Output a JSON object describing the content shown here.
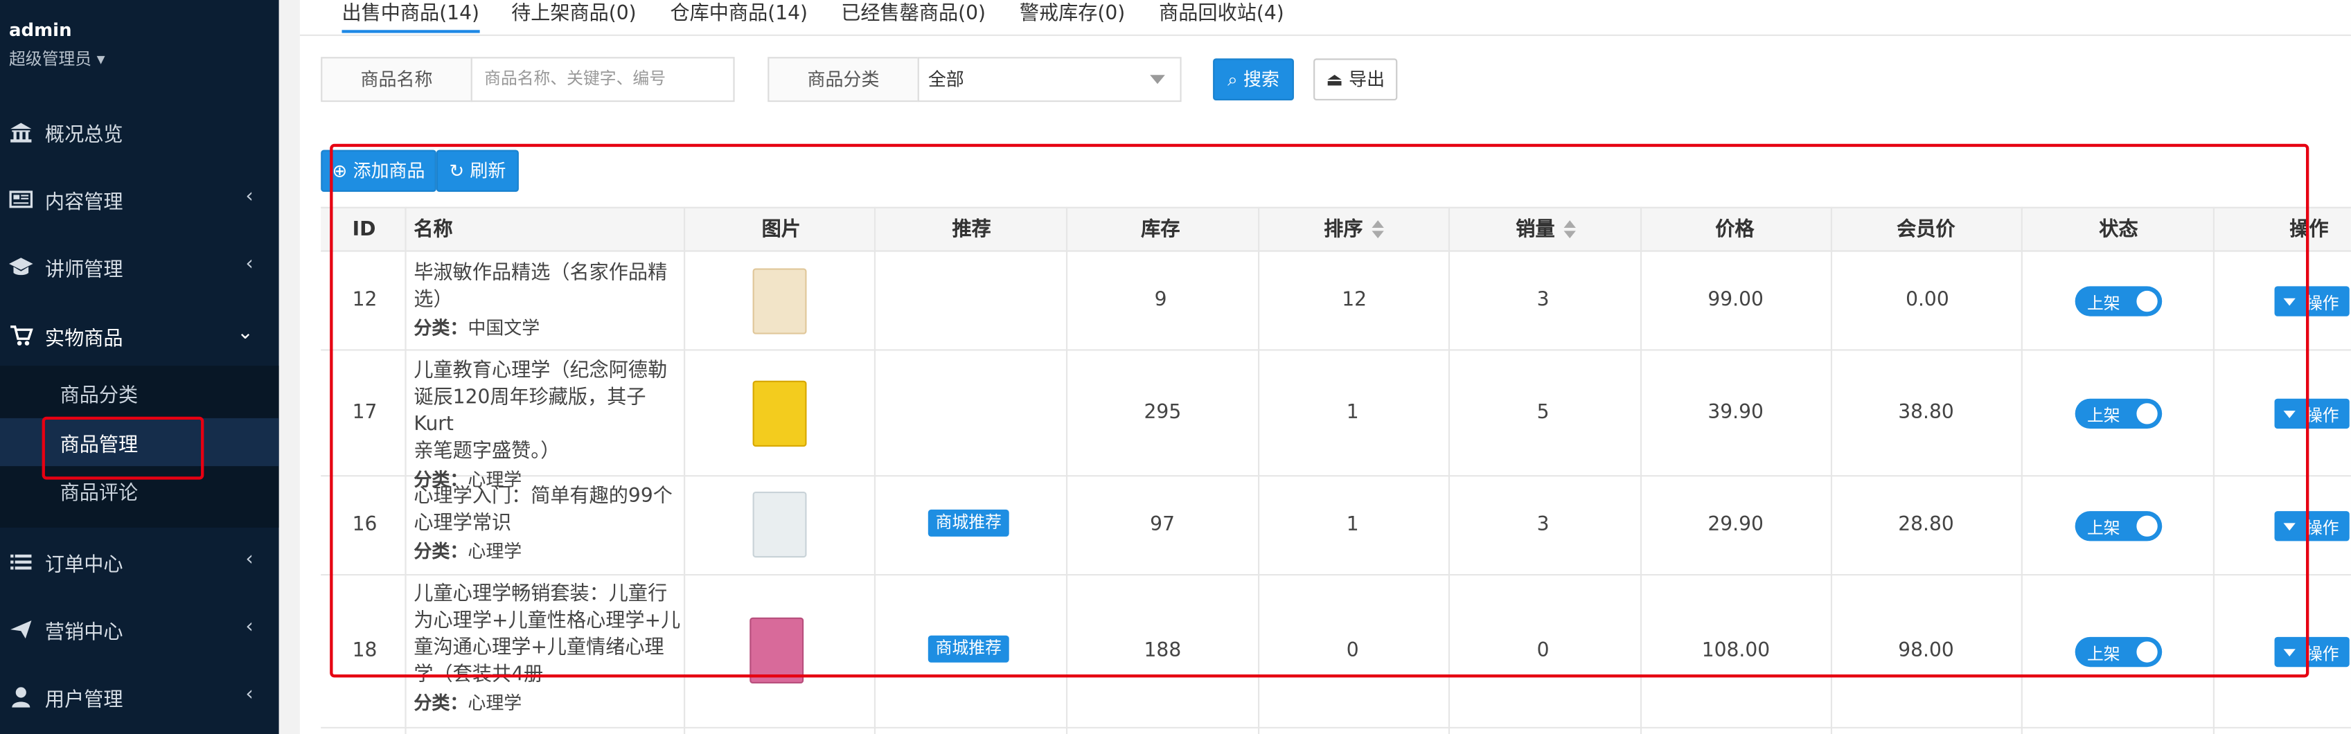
{
  "sidebar": {
    "user_name": "admin",
    "user_role": "超级管理员",
    "items": [
      {
        "label": "概况总览",
        "icon": "bank-icon"
      },
      {
        "label": "内容管理",
        "icon": "newspaper-icon"
      },
      {
        "label": "讲师管理",
        "icon": "graduation-cap-icon"
      },
      {
        "label": "实物商品",
        "icon": "cart-icon"
      },
      {
        "label": "订单中心",
        "icon": "list-icon"
      },
      {
        "label": "营销中心",
        "icon": "send-icon"
      },
      {
        "label": "用户管理",
        "icon": "user-icon"
      }
    ],
    "sub_items": [
      {
        "label": "商品分类"
      },
      {
        "label": "商品管理"
      },
      {
        "label": "商品评论"
      }
    ]
  },
  "tabs": [
    {
      "label": "出售中商品(14)"
    },
    {
      "label": "待上架商品(0)"
    },
    {
      "label": "仓库中商品(14)"
    },
    {
      "label": "已经售罄商品(0)"
    },
    {
      "label": "警戒库存(0)"
    },
    {
      "label": "商品回收站(4)"
    }
  ],
  "filters": {
    "name_label": "商品名称",
    "name_placeholder": "商品名称、关键字、编号",
    "category_label": "商品分类",
    "category_value": "全部",
    "search_label": "搜索",
    "export_label": "导出"
  },
  "actions": {
    "add_label": "添加商品",
    "refresh_label": "刷新"
  },
  "table": {
    "headers": {
      "id": "ID",
      "name": "名称",
      "image": "图片",
      "recommend": "推荐",
      "stock": "库存",
      "sort": "排序",
      "sales": "销量",
      "price": "价格",
      "member_price": "会员价",
      "status": "状态",
      "ops": "操作"
    },
    "category_prefix": "分类：",
    "status_label": "上架",
    "op_label": "操作",
    "rows": [
      {
        "id": "12",
        "name_lines": [
          "毕淑敏作品精选（名家作品精",
          "选）"
        ],
        "category": "中国文学",
        "recommend": "",
        "stock": "9",
        "sort": "12",
        "sales": "3",
        "price": "99.00",
        "member_price": "0.00",
        "thumb_color": "#f2e4c8"
      },
      {
        "id": "17",
        "name_lines": [
          "儿童教育心理学（纪念阿德勒",
          "诞辰120周年珍藏版，其子Kurt",
          "亲笔题字盛赞。）"
        ],
        "category": "心理学",
        "recommend": "",
        "stock": "295",
        "sort": "1",
        "sales": "5",
        "price": "39.90",
        "member_price": "38.80",
        "thumb_color": "#f3cc1e"
      },
      {
        "id": "16",
        "name_lines": [
          "心理学入门：简单有趣的99个",
          "心理学常识"
        ],
        "category": "心理学",
        "recommend": "商城推荐",
        "stock": "97",
        "sort": "1",
        "sales": "3",
        "price": "29.90",
        "member_price": "28.80",
        "thumb_color": "#e9eef0"
      },
      {
        "id": "18",
        "name_lines": [
          "儿童心理学畅销套装：儿童行",
          "为心理学+儿童性格心理学+儿",
          "童沟通心理学+儿童情绪心理",
          "学（套装共4册"
        ],
        "category": "心理学",
        "recommend": "商城推荐",
        "stock": "188",
        "sort": "0",
        "sales": "0",
        "price": "108.00",
        "member_price": "98.00",
        "thumb_color": "#d86a9a"
      }
    ]
  },
  "colors": {
    "sidebar_bg": "#0b1e33",
    "accent": "#1e8ee2",
    "highlight_red": "#e60012"
  }
}
